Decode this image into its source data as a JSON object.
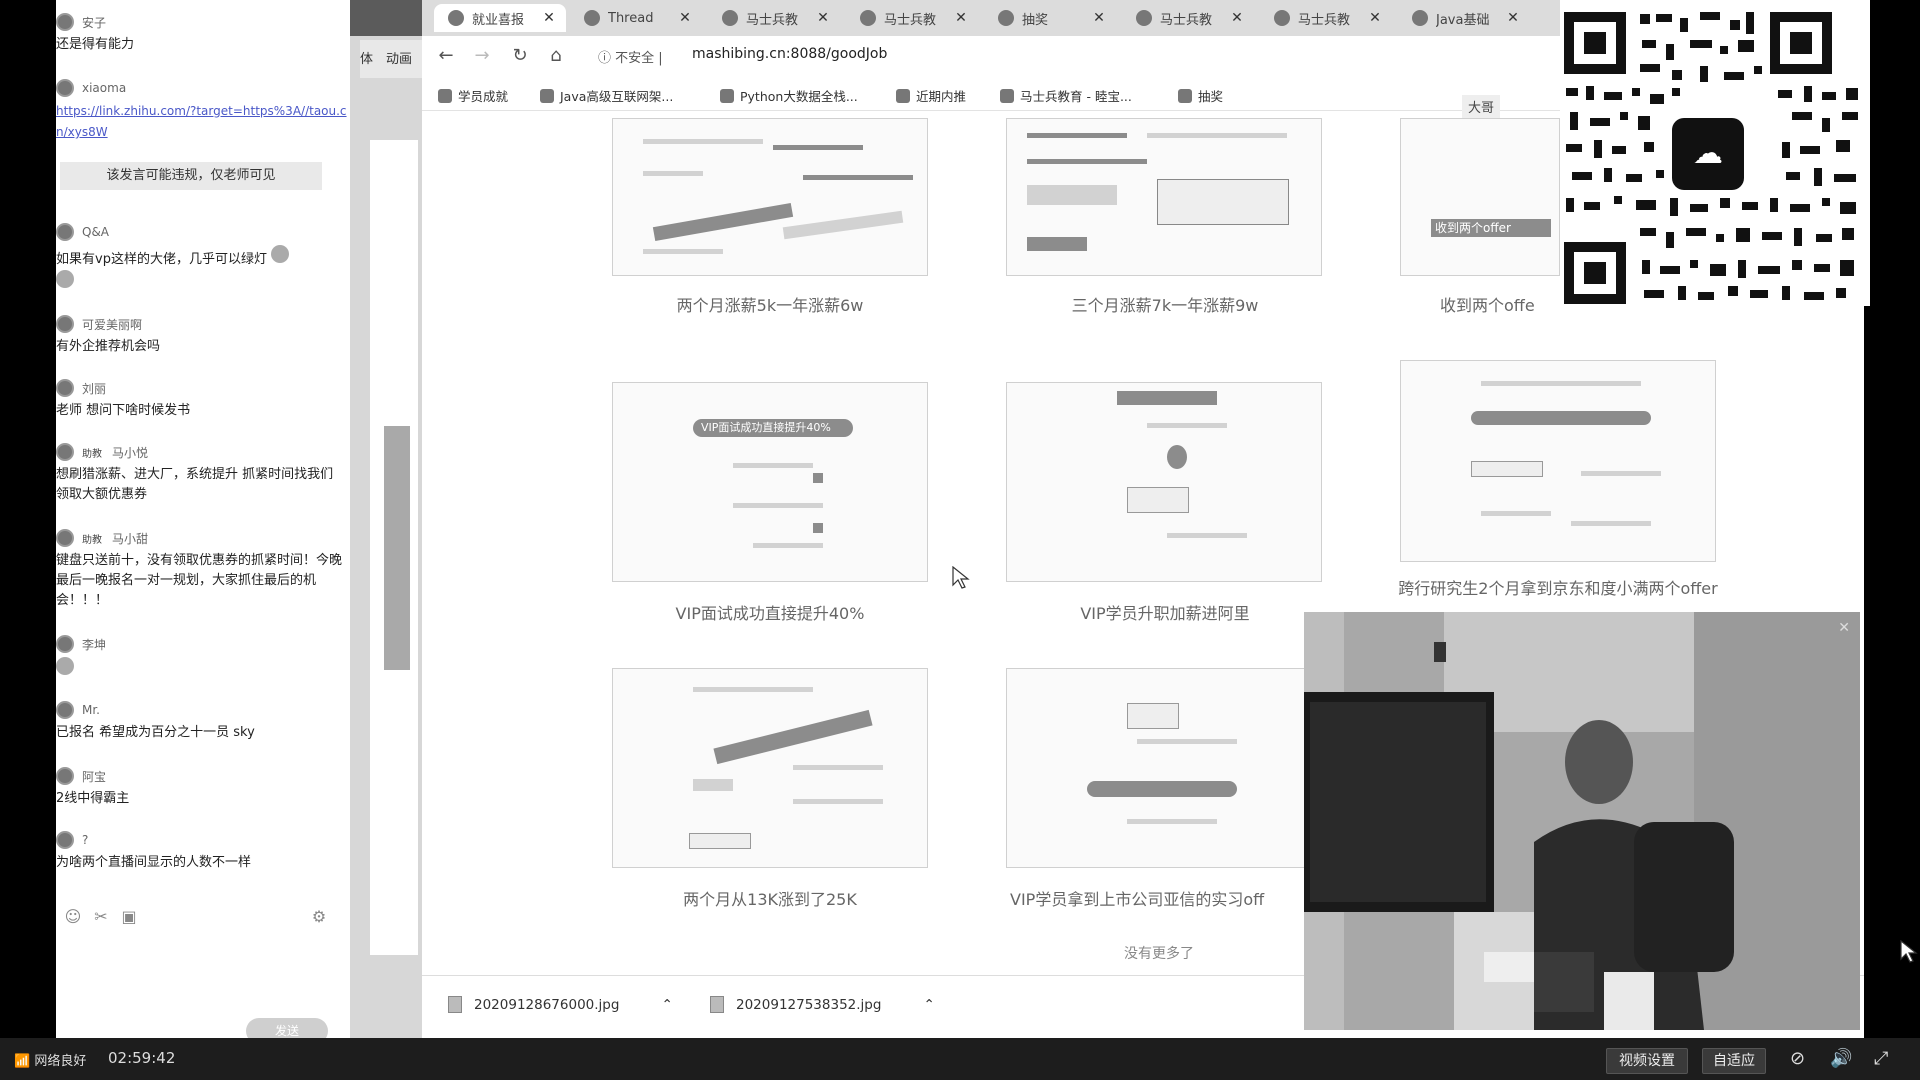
{
  "chat": {
    "messages": [
      {
        "user": "安子",
        "text": "还是得有能力"
      },
      {
        "user": "xiaoma",
        "link": "https://link.zhihu.com/?target=https%3A//taou.cn/xys8W"
      },
      {
        "notice": "该发言可能违规，仅老师可见"
      },
      {
        "user": "Q&A",
        "text": "如果有vp这样的大佬，几乎可以绿灯"
      },
      {
        "user": "可爱美丽啊",
        "text": "有外企推荐机会吗"
      },
      {
        "user": "刘丽",
        "text": "老师 想问下啥时候发书"
      },
      {
        "role": "助教",
        "user": "马小悦",
        "text": "想刷猎涨薪、进大厂，系统提升 抓紧时间找我们 领取大额优惠券"
      },
      {
        "role": "助教",
        "user": "马小甜",
        "text": "键盘只送前十，没有领取优惠券的抓紧时间！今晚最后一晚报名一对一规划，大家抓住最后的机会！！！"
      },
      {
        "user": "李坤",
        "text": ""
      },
      {
        "user": "Mr.",
        "text": "已报名 希望成为百分之十一员 sky"
      },
      {
        "user": "阿宝",
        "text": "2线中得霸主"
      },
      {
        "user": "?",
        "text": "为啥两个直播间显示的人数不一样"
      }
    ],
    "send_label": "发送"
  },
  "mid": {
    "tab_text": "动画",
    "left_text": "体"
  },
  "browser": {
    "tabs": [
      {
        "title": "就业喜报"
      },
      {
        "title": "Thread"
      },
      {
        "title": "马士兵教"
      },
      {
        "title": "马士兵教"
      },
      {
        "title": "抽奖"
      },
      {
        "title": "马士兵教"
      },
      {
        "title": "马士兵教"
      },
      {
        "title": "Java基础"
      }
    ],
    "secure": "不安全",
    "url": "mashibing.cn:8088/goodJob",
    "bookmarks": [
      "学员成就",
      "Java高级互联网架...",
      "Python大数据全栈...",
      "近期内推",
      "马士兵教育 - 睦宝...",
      "抽奖"
    ]
  },
  "cards": [
    {
      "caption": "两个月涨薪5k一年涨薪6w"
    },
    {
      "caption": "三个月涨薪7k一年涨薪9w"
    },
    {
      "caption": "收到两个offe"
    },
    {
      "caption": "VIP面试成功直接提升40%"
    },
    {
      "caption": "VIP学员升职加薪进阿里"
    },
    {
      "caption": "跨行研究生2个月拿到京东和度小满两个offer"
    },
    {
      "caption": "两个月从13K涨到了25K"
    },
    {
      "caption": "VIP学员拿到上市公司亚信的实习off"
    }
  ],
  "card_inner": {
    "top_tag": "大哥",
    "offer_tag": "收到两个offer",
    "vip_banner": "VIP面试成功直接提升40%"
  },
  "no_more": "没有更多了",
  "downloads": [
    {
      "file": "20209128676000.jpg"
    },
    {
      "file": "20209127538352.jpg"
    }
  ],
  "bottom": {
    "network": "网络良好",
    "time": "02:59:42",
    "video_settings": "视频设置",
    "adapt": "自适应"
  },
  "colors": {
    "link": "#4a58c8",
    "bottom_bar": "#1d1d1d"
  }
}
